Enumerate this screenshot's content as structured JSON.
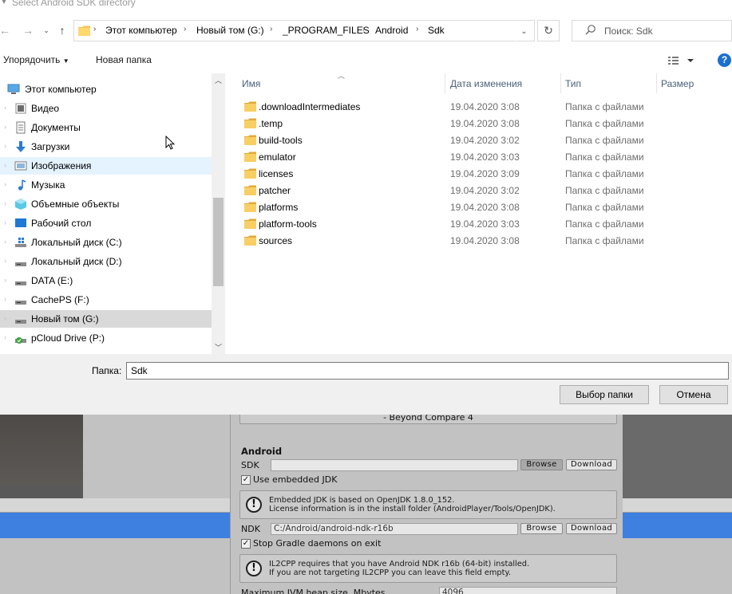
{
  "window": {
    "title": "Select Android SDK directory"
  },
  "navigation": {
    "breadcrumb": [
      "Этот компьютер",
      "Новый том (G:)",
      "_PROGRAM_FILES",
      "Android",
      "Sdk"
    ],
    "search_placeholder": "Поиск: Sdk"
  },
  "toolbar": {
    "organize_label": "Упорядочить",
    "new_folder_label": "Новая папка"
  },
  "sidebar": {
    "items": [
      {
        "label": "Этот компьютер",
        "icon": "computer-icon"
      },
      {
        "label": "Видео",
        "icon": "video-folder-icon"
      },
      {
        "label": "Документы",
        "icon": "documents-folder-icon"
      },
      {
        "label": "Загрузки",
        "icon": "downloads-folder-icon"
      },
      {
        "label": "Изображения",
        "icon": "pictures-folder-icon",
        "state": "hover"
      },
      {
        "label": "Музыка",
        "icon": "music-folder-icon"
      },
      {
        "label": "Объемные объекты",
        "icon": "3d-objects-icon"
      },
      {
        "label": "Рабочий стол",
        "icon": "desktop-icon"
      },
      {
        "label": "Локальный диск (C:)",
        "icon": "drive-icon"
      },
      {
        "label": "Локальный диск (D:)",
        "icon": "drive-icon"
      },
      {
        "label": "DATA (E:)",
        "icon": "drive-icon"
      },
      {
        "label": "CachePS (F:)",
        "icon": "drive-icon"
      },
      {
        "label": "Новый том (G:)",
        "icon": "drive-icon",
        "state": "selected"
      },
      {
        "label": "pCloud Drive (P:)",
        "icon": "cloud-drive-icon"
      }
    ]
  },
  "file_list": {
    "columns": [
      "Имя",
      "Дата изменения",
      "Тип",
      "Размер"
    ],
    "rows": [
      {
        "name": ".downloadIntermediates",
        "date": "19.04.2020 3:08",
        "type": "Папка с файлами"
      },
      {
        "name": ".temp",
        "date": "19.04.2020 3:08",
        "type": "Папка с файлами"
      },
      {
        "name": "build-tools",
        "date": "19.04.2020 3:02",
        "type": "Папка с файлами"
      },
      {
        "name": "emulator",
        "date": "19.04.2020 3:03",
        "type": "Папка с файлами"
      },
      {
        "name": "licenses",
        "date": "19.04.2020 3:09",
        "type": "Папка с файлами"
      },
      {
        "name": "patcher",
        "date": "19.04.2020 3:02",
        "type": "Папка с файлами"
      },
      {
        "name": "platforms",
        "date": "19.04.2020 3:08",
        "type": "Папка с файлами"
      },
      {
        "name": "platform-tools",
        "date": "19.04.2020 3:03",
        "type": "Папка с файлами"
      },
      {
        "name": "sources",
        "date": "19.04.2020 3:08",
        "type": "Папка с файлами"
      }
    ]
  },
  "footer": {
    "folder_label": "Папка:",
    "folder_value": "Sdk",
    "select_button": "Выбор папки",
    "cancel_button": "Отмена"
  },
  "unity_prefs": {
    "beyond_compare": "- Beyond Compare 4",
    "section_title": "Android",
    "sdk_label": "SDK",
    "sdk_value": "",
    "browse_label": "Browse",
    "download_label": "Download",
    "embedded_jdk_label": "Use embedded JDK",
    "embedded_jdk_checked": true,
    "jdk_info_line1": "Embedded JDK is based on OpenJDK 1.8.0_152.",
    "jdk_info_line2": "License information is in the install folder (AndroidPlayer/Tools/OpenJDK).",
    "ndk_label": "NDK",
    "ndk_value": "C:/Android/android-ndk-r16b",
    "gradle_label": "Stop Gradle daemons on exit",
    "gradle_checked": true,
    "il2cpp_line1": "IL2CPP requires that you have Android NDK r16b (64-bit) installed.",
    "il2cpp_line2": "If you are not targeting IL2CPP you can leave this field empty.",
    "jvm_label": "Maximum JVM heap size, Mbytes",
    "jvm_value": "4096"
  },
  "colors": {
    "accent_blue": "#3d80df",
    "folder_yellow": "#f4c45a",
    "hover_blue": "#e5f3ff",
    "selected_gray": "#d9d9d9",
    "help_blue": "#1a6fd1"
  }
}
